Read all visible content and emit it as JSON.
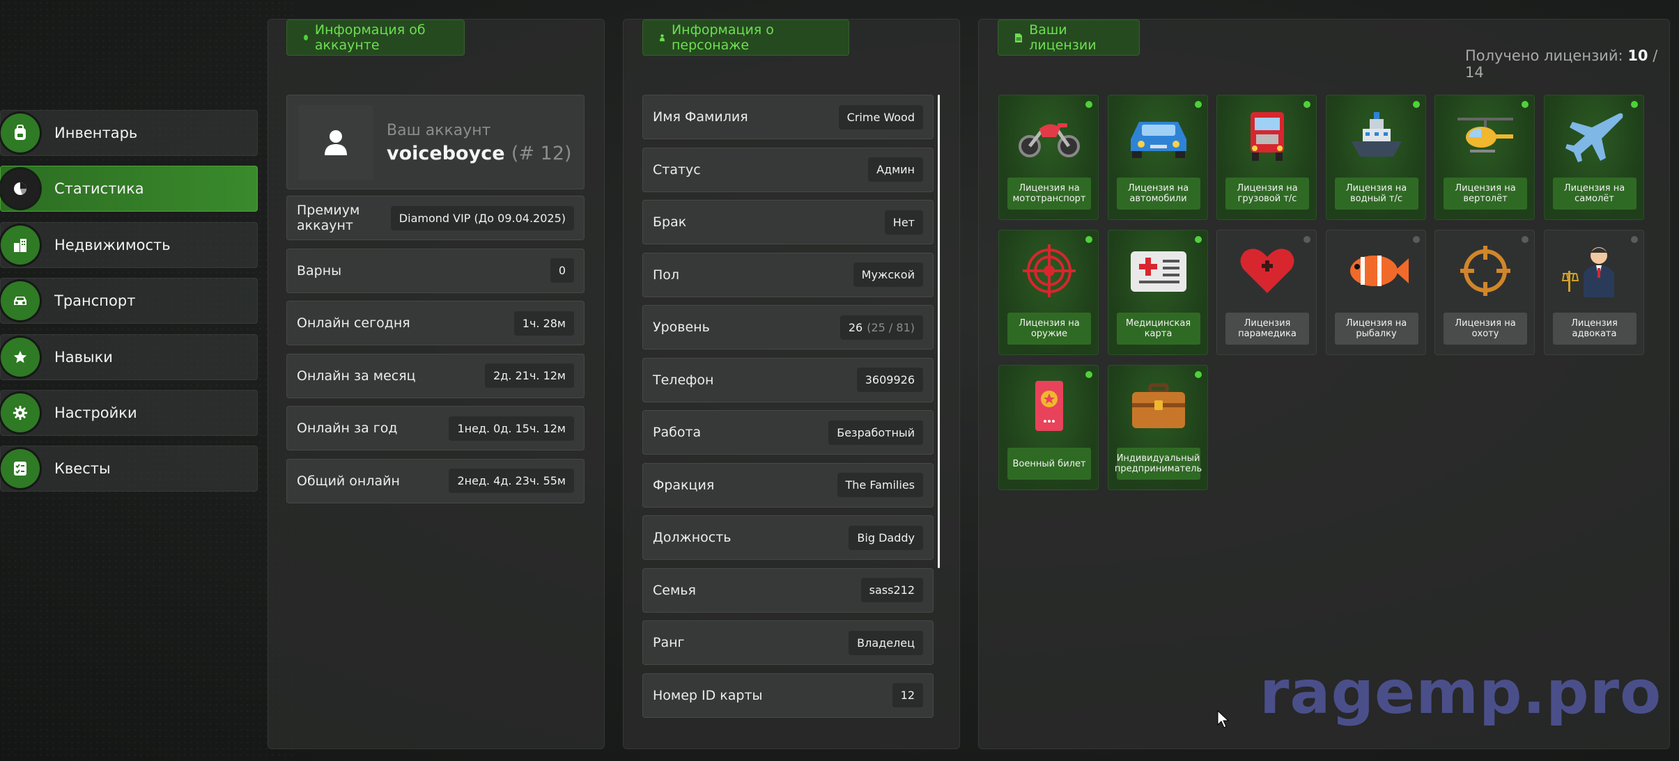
{
  "sidebar": {
    "items": [
      {
        "label": "Инвентарь",
        "icon": "backpack-icon",
        "active": false
      },
      {
        "label": "Статистика",
        "icon": "pie-chart-icon",
        "active": true
      },
      {
        "label": "Недвижимость",
        "icon": "buildings-icon",
        "active": false
      },
      {
        "label": "Транспорт",
        "icon": "car-icon",
        "active": false
      },
      {
        "label": "Навыки",
        "icon": "star-icon",
        "active": false
      },
      {
        "label": "Настройки",
        "icon": "gear-icon",
        "active": false
      },
      {
        "label": "Квесты",
        "icon": "checklist-icon",
        "active": false
      }
    ]
  },
  "account": {
    "title": "Информация об аккаунте",
    "subtitle": "Ваш аккаунт",
    "username": "voiceboyce",
    "id": "(# 12)",
    "rows": [
      {
        "label": "Премиум аккаунт",
        "value": "Diamond VIP (До 09.04.2025)"
      },
      {
        "label": "Варны",
        "value": "0"
      },
      {
        "label": "Онлайн сегодня",
        "value": "1ч. 28м"
      },
      {
        "label": "Онлайн за месяц",
        "value": "2д. 21ч. 12м"
      },
      {
        "label": "Онлайн за год",
        "value": "1нед. 0д. 15ч. 12м"
      },
      {
        "label": "Общий онлайн",
        "value": "2нед. 4д. 23ч. 55м"
      }
    ]
  },
  "character": {
    "title": "Информация о персонаже",
    "rows": [
      {
        "label": "Имя Фамилия",
        "value": "Crime Wood"
      },
      {
        "label": "Статус",
        "value": "Админ"
      },
      {
        "label": "Брак",
        "value": "Нет"
      },
      {
        "label": "Пол",
        "value": "Мужской"
      },
      {
        "label": "Уровень",
        "value": "26",
        "extra": "(25 / 81)"
      },
      {
        "label": "Телефон",
        "value": "3609926"
      },
      {
        "label": "Работа",
        "value": "Безработный"
      },
      {
        "label": "Фракция",
        "value": "The Families"
      },
      {
        "label": "Должность",
        "value": "Big Daddy"
      },
      {
        "label": "Семья",
        "value": "sass212"
      },
      {
        "label": "Ранг",
        "value": "Владелец"
      },
      {
        "label": "Номер ID карты",
        "value": "12"
      }
    ]
  },
  "licenses": {
    "title": "Ваши лицензии",
    "count_label": "Получено лицензий:",
    "count_have": "10",
    "count_sep": "/",
    "count_total": "14",
    "items": [
      {
        "label": "Лицензия на мототранспорт",
        "icon": "motorcycle-icon",
        "owned": true
      },
      {
        "label": "Лицензия на автомобили",
        "icon": "car-icon",
        "owned": true
      },
      {
        "label": "Лицензия на грузовой т/с",
        "icon": "truck-icon",
        "owned": true
      },
      {
        "label": "Лицензия на водный т/с",
        "icon": "ship-icon",
        "owned": true
      },
      {
        "label": "Лицензия на вертолёт",
        "icon": "helicopter-icon",
        "owned": true
      },
      {
        "label": "Лицензия на самолёт",
        "icon": "airplane-icon",
        "owned": true
      },
      {
        "label": "Лицензия на оружие",
        "icon": "target-icon",
        "owned": true
      },
      {
        "label": "Медицинская карта",
        "icon": "medical-card-icon",
        "owned": true
      },
      {
        "label": "Лицензия парамедика",
        "icon": "heart-icon",
        "owned": false
      },
      {
        "label": "Лицензия на рыбалку",
        "icon": "fish-icon",
        "owned": false
      },
      {
        "label": "Лицензия на охоту",
        "icon": "crosshair-icon",
        "owned": false
      },
      {
        "label": "Лицензия адвоката",
        "icon": "lawyer-icon",
        "owned": false
      },
      {
        "label": "Военный билет",
        "icon": "military-id-icon",
        "owned": true
      },
      {
        "label": "Индивидуальный предприниматель",
        "icon": "briefcase-icon",
        "owned": true
      }
    ]
  },
  "watermark": "ragemp.pro"
}
